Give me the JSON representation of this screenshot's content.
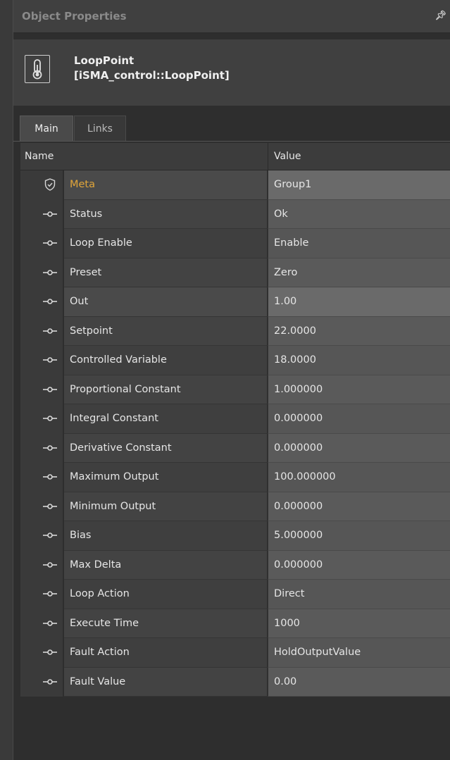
{
  "panel": {
    "title": "Object Properties",
    "pin_icon": "pin-icon"
  },
  "object": {
    "name": "LoopPoint",
    "type": "[iSMA_control::LoopPoint]",
    "icon": "thermometer-icon"
  },
  "tabs": [
    {
      "label": "Main",
      "active": true
    },
    {
      "label": "Links",
      "active": false
    }
  ],
  "grid": {
    "col_name": "Name",
    "col_value": "Value",
    "rows": [
      {
        "name": "Meta",
        "value": "Group1",
        "icon": "shield-icon"
      },
      {
        "name": "Status",
        "value": "Ok",
        "icon": "slot-icon"
      },
      {
        "name": "Loop Enable",
        "value": "Enable",
        "icon": "slot-icon"
      },
      {
        "name": "Preset",
        "value": "Zero",
        "icon": "slot-icon"
      },
      {
        "name": "Out",
        "value": "1.00",
        "icon": "slot-icon"
      },
      {
        "name": "Setpoint",
        "value": "22.0000",
        "icon": "slot-icon"
      },
      {
        "name": "Controlled Variable",
        "value": "18.0000",
        "icon": "slot-icon"
      },
      {
        "name": "Proportional Constant",
        "value": "1.000000",
        "icon": "slot-icon"
      },
      {
        "name": "Integral Constant",
        "value": "0.000000",
        "icon": "slot-icon"
      },
      {
        "name": "Derivative Constant",
        "value": "0.000000",
        "icon": "slot-icon"
      },
      {
        "name": "Maximum Output",
        "value": "100.000000",
        "icon": "slot-icon"
      },
      {
        "name": "Minimum Output",
        "value": "0.000000",
        "icon": "slot-icon"
      },
      {
        "name": "Bias",
        "value": "5.000000",
        "icon": "slot-icon"
      },
      {
        "name": "Max Delta",
        "value": "0.000000",
        "icon": "slot-icon"
      },
      {
        "name": "Loop Action",
        "value": "Direct",
        "icon": "slot-icon"
      },
      {
        "name": "Execute Time",
        "value": "1000",
        "icon": "slot-icon"
      },
      {
        "name": "Fault Action",
        "value": "HoldOutputValue",
        "icon": "slot-icon"
      },
      {
        "name": "Fault Value",
        "value": "0.00",
        "icon": "slot-icon"
      }
    ]
  },
  "colors": {
    "meta_text": "#e0a53a",
    "panel_bg": "#2e2e2e",
    "value_bg": "#565656"
  }
}
